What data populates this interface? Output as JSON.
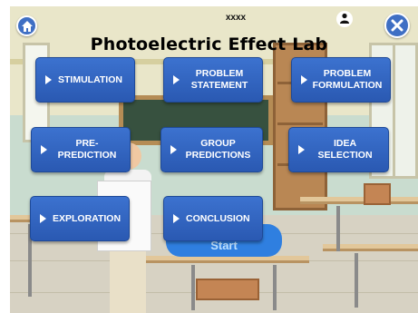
{
  "header": {
    "username": "xxxx",
    "title": "Photoelectric Effect Lab",
    "home_icon": "home-icon",
    "user_icon": "user-icon",
    "close_icon": "close-icon"
  },
  "menu": {
    "stimulation": "STIMULATION",
    "problem_statement": "PROBLEM\nSTATEMENT",
    "problem_formulation": "PROBLEM\nFORMULATION",
    "pre_prediction": "PRE-\nPREDICTION",
    "group_predictions": "GROUP\nPREDICTIONS",
    "idea_selection": "IDEA\nSELECTION",
    "exploration": "EXPLORATION",
    "conclusion": "CONCLUSION"
  },
  "background": {
    "start_button": "Start"
  },
  "colors": {
    "tile": "#3c72cf",
    "tile_border": "#1f4a97",
    "icon_button": "#3f6fc4"
  }
}
